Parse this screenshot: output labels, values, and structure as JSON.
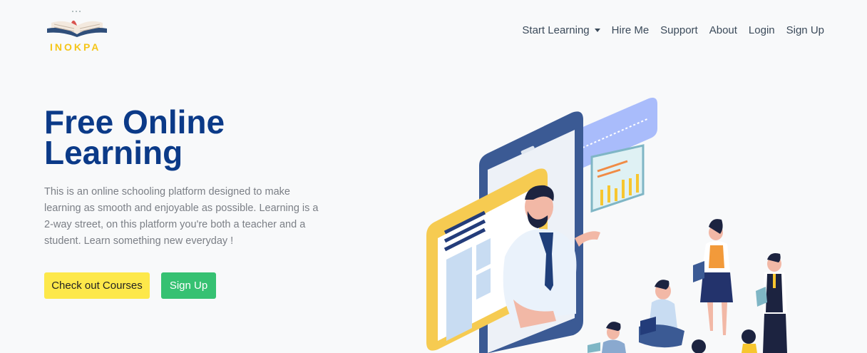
{
  "brand": {
    "name": "INOKPA"
  },
  "nav": {
    "items": [
      {
        "label": "Start Learning",
        "dropdown": true
      },
      {
        "label": "Hire Me"
      },
      {
        "label": "Support"
      },
      {
        "label": "About"
      },
      {
        "label": "Login"
      },
      {
        "label": "Sign Up"
      }
    ]
  },
  "hero": {
    "title": "Free Online Learning",
    "description": "This is an online schooling platform designed to make learning as smooth and enjoyable as possible. Learning is a 2-way street, on this platform you're both a teacher and a student. Learn something new everyday !",
    "primary_button": "Check out Courses",
    "secondary_button": "Sign Up"
  },
  "colors": {
    "title": "#0b3a88",
    "primary_button": "#fde84a",
    "secondary_button": "#36c172",
    "brand_text": "#f5c518"
  }
}
